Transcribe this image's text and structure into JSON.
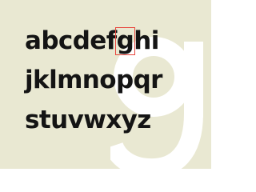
{
  "specimen": {
    "lines": [
      [
        "a",
        "b",
        "c",
        "d",
        "e",
        "f",
        "g",
        "h",
        "i"
      ],
      [
        "j",
        "k",
        "l",
        "m",
        "n",
        "o",
        "p",
        "q",
        "r"
      ],
      [
        "s",
        "t",
        "u",
        "v",
        "w",
        "x",
        "y",
        "z"
      ]
    ],
    "highlighted_letter": "g"
  },
  "colors": {
    "background": "#e9e8d2",
    "text": "#141414",
    "highlight_box": "#e8463d",
    "background_glyph": "#ffffff"
  }
}
